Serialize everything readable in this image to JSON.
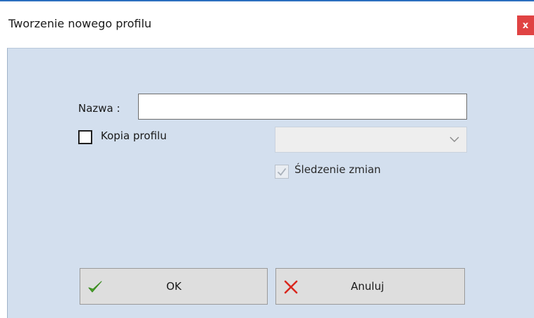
{
  "window": {
    "title": "Tworzenie nowego profilu",
    "close_glyph": "x",
    "accent_color": "#2b6fbf",
    "close_color": "#e04343"
  },
  "form": {
    "name_label": "Nazwa :",
    "name_value": "",
    "copy_profile": {
      "label": "Kopia profilu",
      "checked": false
    },
    "profile_select": {
      "value": "",
      "enabled": false,
      "icon": "chevron-down-icon"
    },
    "track_changes": {
      "label": "Śledzenie zmian",
      "checked": true,
      "enabled": false,
      "icon": "check-icon"
    }
  },
  "buttons": {
    "ok": {
      "label": "OK",
      "icon": "check-icon",
      "icon_color": "#4aa329"
    },
    "cancel": {
      "label": "Anuluj",
      "icon": "close-icon",
      "icon_color": "#d9281e"
    }
  },
  "colors": {
    "client_background": "#d3dfee",
    "button_background": "#dedede"
  }
}
